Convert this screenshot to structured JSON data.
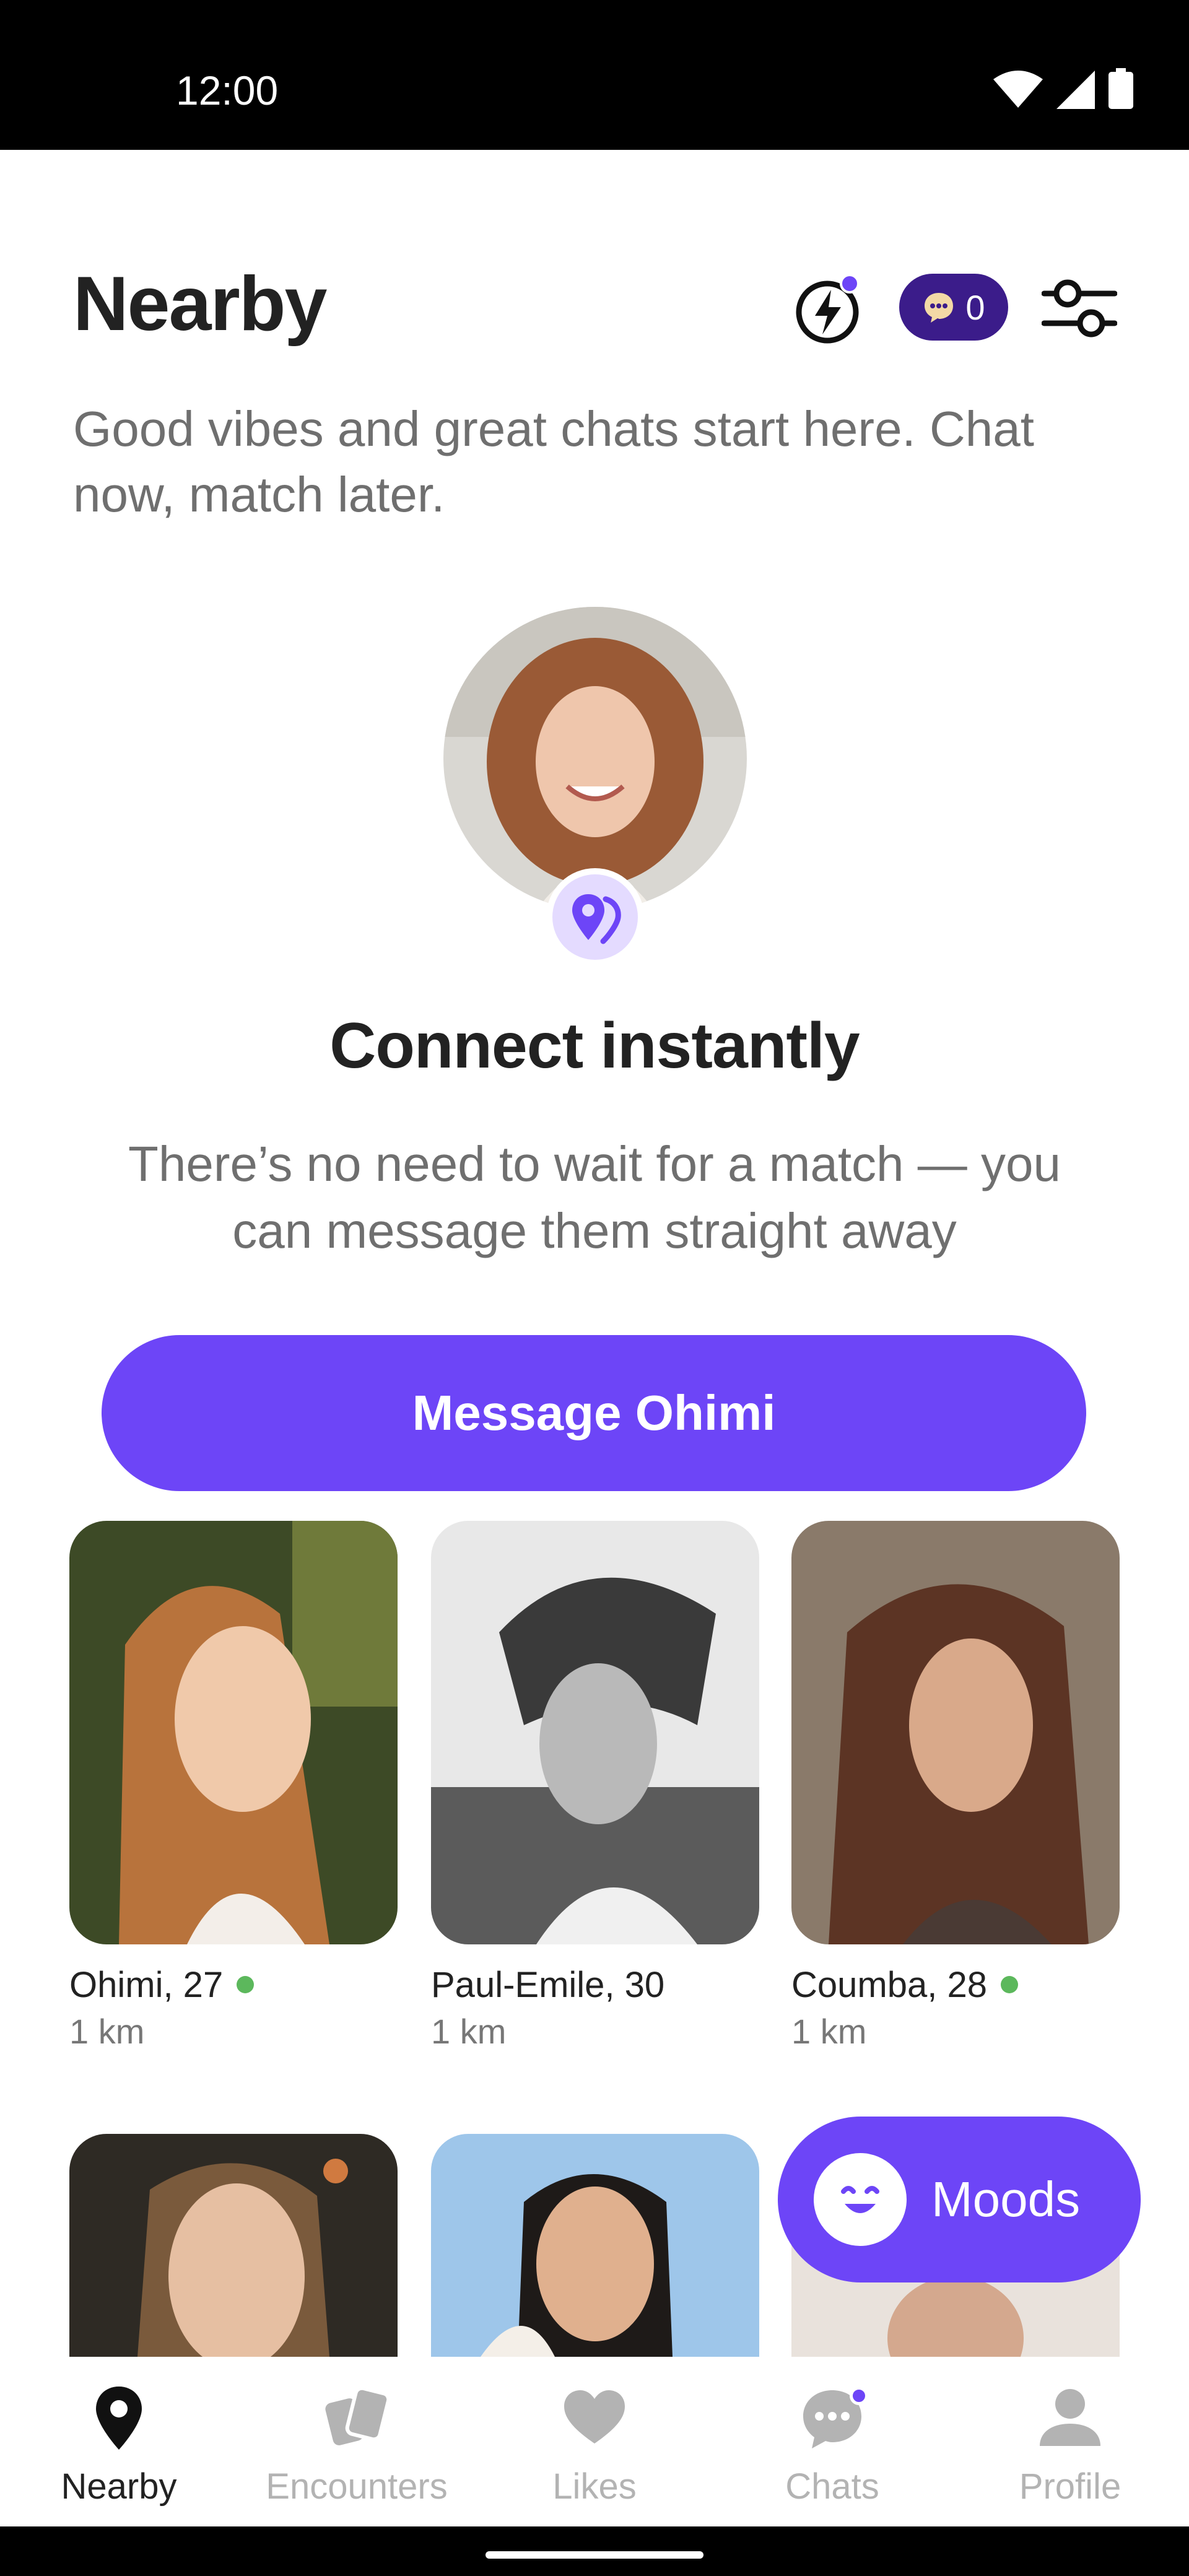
{
  "status_bar": {
    "time": "12:00"
  },
  "header": {
    "title": "Nearby",
    "coins_count": "0",
    "subtitle": "Good vibes and great chats start here. Chat now, match later."
  },
  "hero": {
    "title": "Connect instantly",
    "description": "There’s no need to wait for a match — you can message them straight away",
    "cta_label": "Message Ohimi"
  },
  "profiles": [
    {
      "name": "Ohimi, 27",
      "distance": "1 km",
      "online": true
    },
    {
      "name": "Paul-Emile, 30",
      "distance": "1 km",
      "online": false
    },
    {
      "name": "Coumba, 28",
      "distance": "1 km",
      "online": true
    }
  ],
  "moods": {
    "label": "Moods"
  },
  "nav": {
    "items": [
      {
        "label": "Nearby",
        "icon": "location-pin-icon",
        "active": true
      },
      {
        "label": "Encounters",
        "icon": "cards-icon",
        "active": false
      },
      {
        "label": "Likes",
        "icon": "heart-icon",
        "active": false
      },
      {
        "label": "Chats",
        "icon": "chat-bubble-icon",
        "active": false
      },
      {
        "label": "Profile",
        "icon": "person-icon",
        "active": false
      }
    ]
  },
  "colors": {
    "accent": "#6d45f7",
    "coins_bg": "#3b1c8a",
    "online": "#5cb85c",
    "text_primary": "#222222",
    "text_secondary": "#6f6f6f",
    "inactive": "#b3b3b3"
  }
}
